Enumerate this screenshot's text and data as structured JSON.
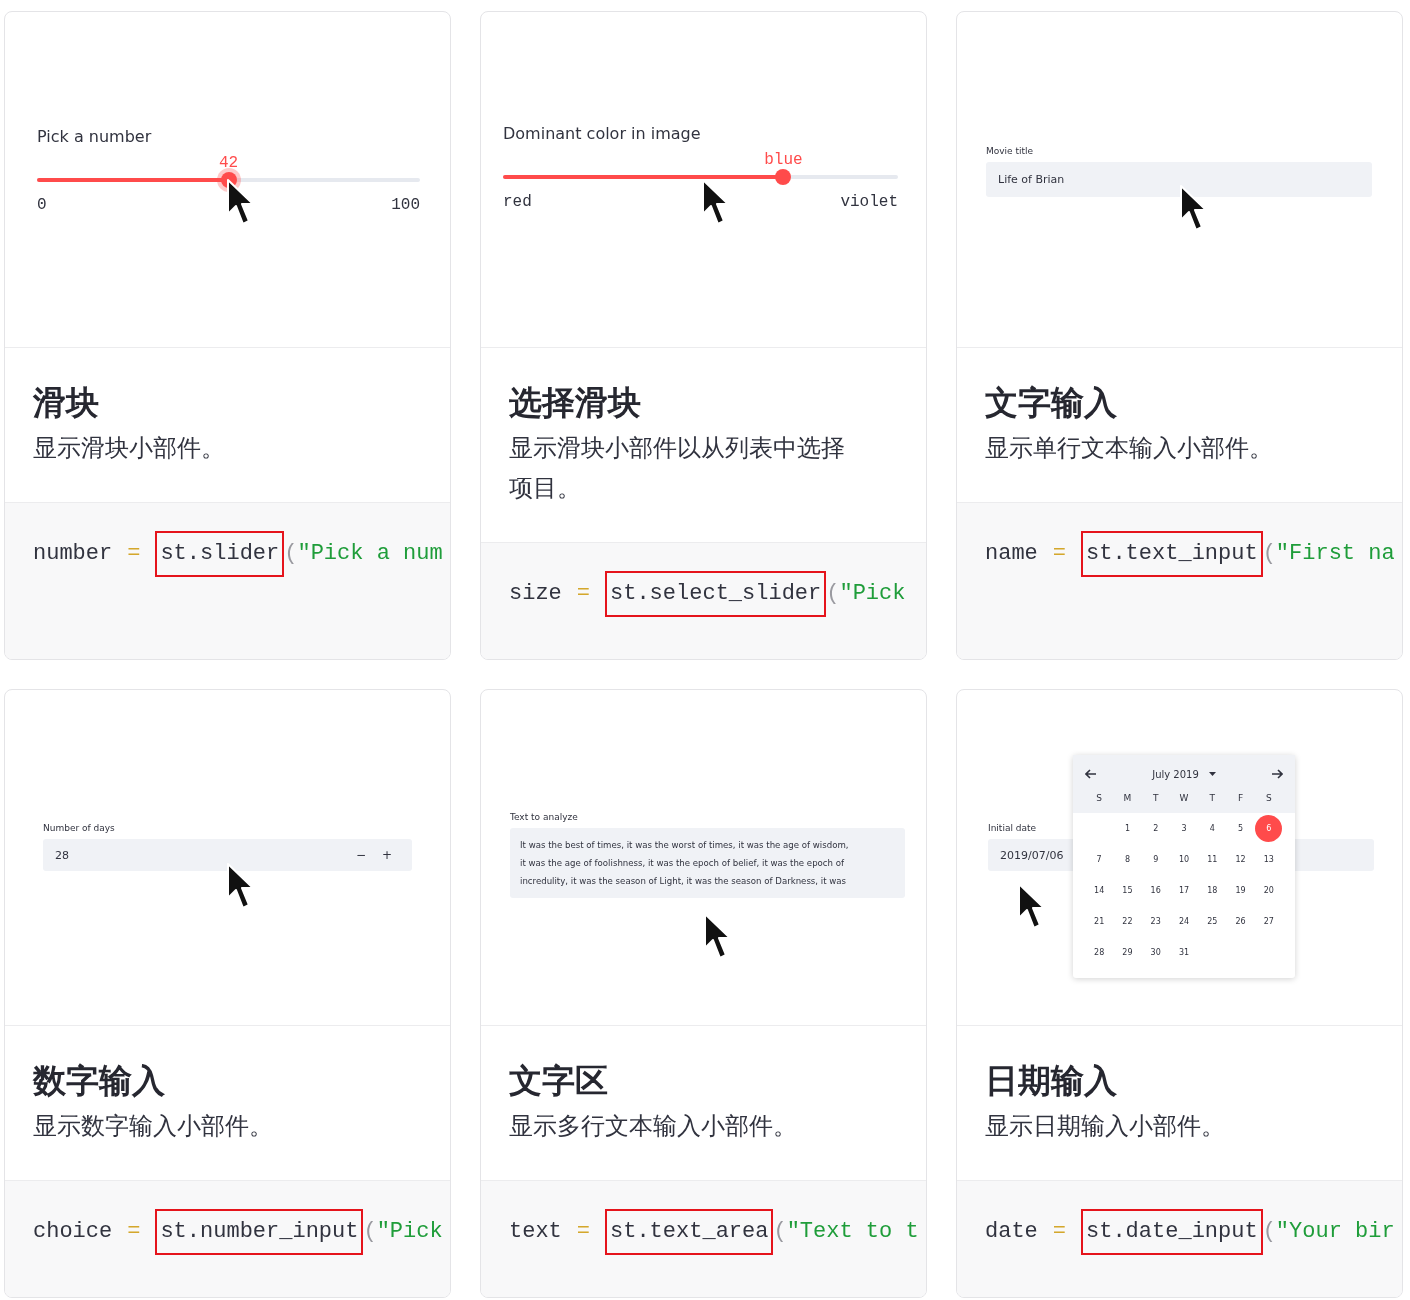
{
  "cards": [
    {
      "preview": {
        "kind": "slider",
        "label": "Pick a number",
        "value": "42",
        "level": 0.5,
        "min": "0",
        "max": "100",
        "focused": true
      },
      "title": "滑块",
      "description": "显示滑块小部件。",
      "code": [
        {
          "text": "number",
          "kind": "name"
        },
        {
          "text": "=",
          "kind": "operator"
        },
        {
          "text": "st.slider",
          "kind": "call"
        },
        {
          "text": "(",
          "kind": "punct"
        },
        {
          "text": "\"Pick a num",
          "kind": "string"
        }
      ]
    },
    {
      "preview": {
        "kind": "select_slider",
        "label": "Dominant color in image",
        "value": "blue",
        "level": 0.71,
        "min": "red",
        "max": "violet",
        "focused": false
      },
      "title": "选择滑块",
      "description": "显示滑块小部件以从列表中选择项目。",
      "code": [
        {
          "text": "size",
          "kind": "name"
        },
        {
          "text": "=",
          "kind": "operator"
        },
        {
          "text": "st.select_slider",
          "kind": "call"
        },
        {
          "text": "(",
          "kind": "punct"
        },
        {
          "text": "\"Pick",
          "kind": "string"
        }
      ]
    },
    {
      "preview": {
        "kind": "text_input",
        "label": "Movie title",
        "value": "Life of Brian"
      },
      "title": "文字输入",
      "description": "显示单行文本输入小部件。",
      "code": [
        {
          "text": "name",
          "kind": "name"
        },
        {
          "text": "=",
          "kind": "operator"
        },
        {
          "text": "st.text_input",
          "kind": "call"
        },
        {
          "text": "(",
          "kind": "punct"
        },
        {
          "text": "\"First na",
          "kind": "string"
        }
      ]
    },
    {
      "preview": {
        "kind": "number_input",
        "label": "Number of days",
        "value": "28",
        "decrement": "−",
        "increment": "+"
      },
      "title": "数字输入",
      "description": "显示数字输入小部件。",
      "code": [
        {
          "text": "choice",
          "kind": "name"
        },
        {
          "text": "=",
          "kind": "operator"
        },
        {
          "text": "st.number_input",
          "kind": "call"
        },
        {
          "text": "(",
          "kind": "punct"
        },
        {
          "text": "\"Pick",
          "kind": "string"
        }
      ]
    },
    {
      "preview": {
        "kind": "text_area",
        "label": "Text to analyze",
        "value": "It was the best of times, it was the worst of times, it was the age of wisdom,\nit was the age of foolishness, it was the epoch of belief, it was the epoch of\nincredulity, it was the season of Light, it was the season of Darkness, it was"
      },
      "title": "文字区",
      "description": "显示多行文本输入小部件。",
      "code": [
        {
          "text": "text",
          "kind": "name"
        },
        {
          "text": "=",
          "kind": "operator"
        },
        {
          "text": "st.text_area",
          "kind": "call"
        },
        {
          "text": "(",
          "kind": "punct"
        },
        {
          "text": "\"Text to t",
          "kind": "string"
        }
      ]
    },
    {
      "preview": {
        "kind": "date_input",
        "label": "Initial date",
        "value": "2019/07/06",
        "calendar": {
          "month": "July 2019",
          "weekdays": [
            "S",
            "M",
            "T",
            "W",
            "T",
            "F",
            "S"
          ],
          "weeks": [
            [
              {
                "day": "1",
                "selected": false
              },
              {
                "day": "2",
                "selected": false
              },
              {
                "day": "3",
                "selected": false
              },
              {
                "day": "4",
                "selected": false
              },
              {
                "day": "5",
                "selected": false
              },
              {
                "day": "6",
                "selected": true
              }
            ],
            [
              {
                "day": "7",
                "selected": false
              },
              {
                "day": "8",
                "selected": false
              },
              {
                "day": "9",
                "selected": false
              },
              {
                "day": "10",
                "selected": false
              },
              {
                "day": "11",
                "selected": false
              },
              {
                "day": "12",
                "selected": false
              },
              {
                "day": "13",
                "selected": false
              }
            ],
            [
              {
                "day": "14",
                "selected": false
              },
              {
                "day": "15",
                "selected": false
              },
              {
                "day": "16",
                "selected": false
              },
              {
                "day": "17",
                "selected": false
              },
              {
                "day": "18",
                "selected": false
              },
              {
                "day": "19",
                "selected": false
              },
              {
                "day": "20",
                "selected": false
              }
            ],
            [
              {
                "day": "21",
                "selected": false
              },
              {
                "day": "22",
                "selected": false
              },
              {
                "day": "23",
                "selected": false
              },
              {
                "day": "24",
                "selected": false
              },
              {
                "day": "25",
                "selected": false
              },
              {
                "day": "26",
                "selected": false
              },
              {
                "day": "27",
                "selected": false
              }
            ],
            [
              {
                "day": "28",
                "selected": false
              },
              {
                "day": "29",
                "selected": false
              },
              {
                "day": "30",
                "selected": false
              },
              {
                "day": "31",
                "selected": false
              }
            ]
          ]
        }
      },
      "title": "日期输入",
      "description": "显示日期输入小部件。",
      "code": [
        {
          "text": "date",
          "kind": "name"
        },
        {
          "text": "=",
          "kind": "operator"
        },
        {
          "text": "st.date_input",
          "kind": "call"
        },
        {
          "text": "(",
          "kind": "punct"
        },
        {
          "text": "\"Your bir",
          "kind": "string"
        }
      ]
    }
  ]
}
